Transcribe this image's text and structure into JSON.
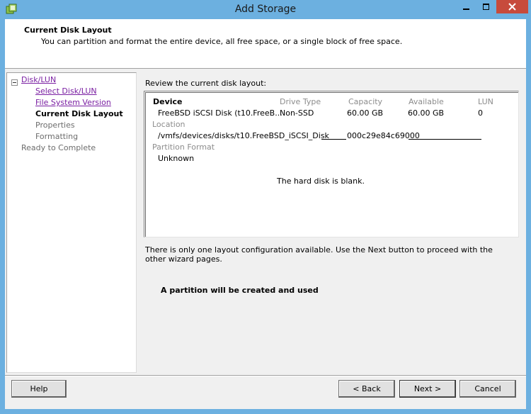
{
  "window": {
    "title": "Add Storage",
    "icon": "vsphere-storage-icon",
    "controls": {
      "minimize": "minimize-icon",
      "maximize": "maximize-icon",
      "close": "close-icon"
    }
  },
  "header": {
    "title": "Current Disk Layout",
    "description": "You can partition and format the entire device, all free space, or a single block of free space."
  },
  "nav": {
    "items": [
      {
        "label": "Disk/LUN",
        "state": "link"
      },
      {
        "label": "Select Disk/LUN",
        "state": "link"
      },
      {
        "label": "File System Version",
        "state": "link"
      },
      {
        "label": "Current Disk Layout",
        "state": "current"
      },
      {
        "label": "Properties",
        "state": "disabled"
      },
      {
        "label": "Formatting",
        "state": "disabled"
      },
      {
        "label": "Ready to Complete",
        "state": "disabled"
      }
    ]
  },
  "content": {
    "review_label": "Review the current disk layout:",
    "table": {
      "headers": {
        "device": "Device",
        "drive_type": "Drive Type",
        "capacity": "Capacity",
        "available": "Available",
        "lun": "LUN"
      },
      "row": {
        "device": "FreeBSD iSCSI Disk (t10.FreeB...",
        "drive_type": "Non-SSD",
        "capacity": "60.00 GB",
        "available": "60.00 GB",
        "lun": "0"
      }
    },
    "location_label": "Location",
    "location_value_a": "/vmfs/devices/disks/t10.FreeBSD_iSCSI_Disk",
    "location_value_b": "000c29e84c69000",
    "partition_format_label": "Partition Format",
    "partition_format_value": "Unknown",
    "blank_message": "The hard disk is blank.",
    "info_text": "There is only one layout configuration available. Use the Next button to proceed with the other wizard pages.",
    "partition_message": "A partition will be created and used"
  },
  "footer": {
    "help": "Help",
    "back": "< Back",
    "next": "Next >",
    "cancel": "Cancel"
  },
  "colors": {
    "titlebar": "#6cb0e0",
    "close_button": "#c74b3c",
    "link": "#7a1fa2",
    "disabled": "#6d6d6d"
  }
}
